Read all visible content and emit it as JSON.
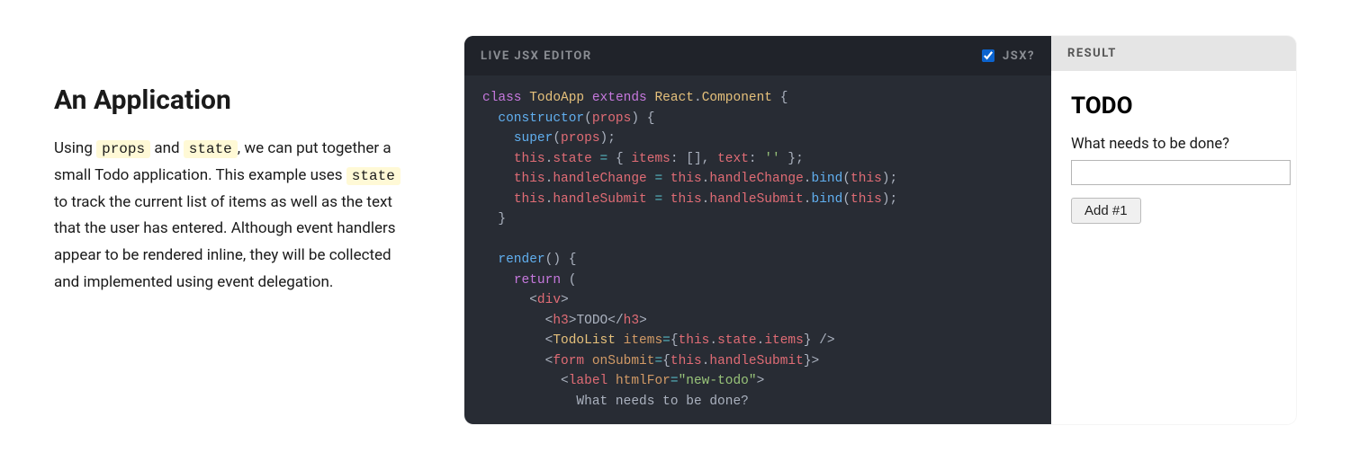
{
  "left": {
    "title": "An Application",
    "desc_before_props": "Using ",
    "code_props": "props",
    "desc_between_props_state": " and ",
    "code_state": "state",
    "desc_after_state": ", we can put together a small Todo application. This example uses ",
    "code_state2": "state",
    "desc_tail": " to track the current list of items as well as the text that the user has entered. Although event handlers appear to be rendered inline, they will be collected and implemented using event delegation."
  },
  "editor": {
    "header_label": "LIVE JSX EDITOR",
    "jsx_label": "JSX?",
    "jsx_checked": true
  },
  "result": {
    "header_label": "RESULT",
    "todo_heading": "TODO",
    "input_label": "What needs to be done?",
    "add_button": "Add #1"
  },
  "code": {
    "t_class": "class",
    "t_TodoApp": "TodoApp",
    "t_extends": "extends",
    "t_React": "React",
    "t_dot": ".",
    "t_Component": "Component",
    "t_lbrace": " {",
    "t_constructor": "constructor",
    "t_lparen": "(",
    "t_props": "props",
    "t_rparen_lbrace": ") {",
    "t_super": "super",
    "t_rparen_semi": ");",
    "t_this": "this",
    "t_state": "state",
    "t_eq": " = ",
    "t_obj_open": "{ ",
    "t_items": "items",
    "t_colon": ": ",
    "t_brackets": "[]",
    "t_comma": ", ",
    "t_text": "text",
    "t_empty_str": "''",
    "t_obj_close_semi": " };",
    "t_handleChange": "handleChange",
    "t_handleSubmit": "handleSubmit",
    "t_bind": "bind",
    "t_rbrace": "}",
    "t_render": "render",
    "t_paren_lbrace": "() {",
    "t_return": "return",
    "t_lparen_only": " (",
    "t_lt": "<",
    "t_div": "div",
    "t_gt": ">",
    "t_h3": "h3",
    "t_TODO": "TODO",
    "t_lt_slash": "</",
    "t_TodoList": "TodoList",
    "t_items_attr": "items",
    "t_eq2": "=",
    "t_lcurly": "{",
    "t_rcurly": "}",
    "t_slash_gt": " />",
    "t_form": "form",
    "t_onSubmit": "onSubmit",
    "t_label": "label",
    "t_htmlFor": "htmlFor",
    "t_new_todo": "\"new-todo\"",
    "t_wnbd": "What needs to be done?"
  }
}
